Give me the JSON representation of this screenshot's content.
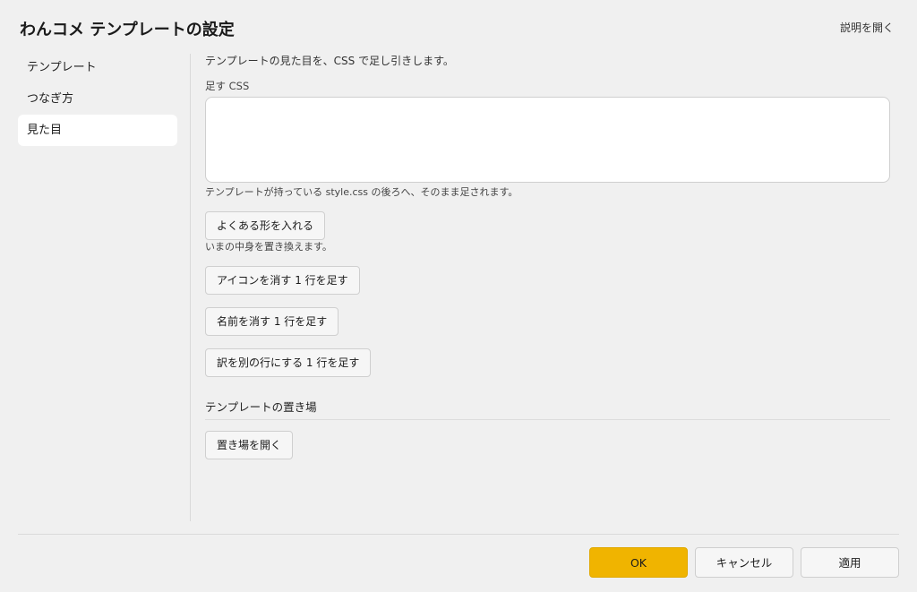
{
  "window": {
    "title": "わんコメ テンプレートの設定",
    "help_link": "説明を開く"
  },
  "sidebar": {
    "items": [
      {
        "label": "テンプレート",
        "active": false
      },
      {
        "label": "つなぎ方",
        "active": false
      },
      {
        "label": "見た目",
        "active": true
      }
    ]
  },
  "main": {
    "intro": "テンプレートの見た目を、CSS で足し引きします。",
    "css_field_label": "足す CSS",
    "css_field_value": "",
    "css_field_note": "テンプレートが持っている style.css の後ろへ、そのまま足されます。",
    "preset_button": "よくある形を入れる",
    "preset_note": "いまの中身を置き換えます。",
    "snippet_buttons": [
      "アイコンを消す 1 行を足す",
      "名前を消す 1 行を足す",
      "訳を別の行にする 1 行を足す"
    ],
    "folder_section_title": "テンプレートの置き場",
    "open_folder_button": "置き場を開く"
  },
  "footer": {
    "ok_label": "OK",
    "cancel_label": "キャンセル",
    "apply_label": "適用"
  },
  "colors": {
    "background": "#f0f0f0",
    "accent": "#f0b400",
    "sidebar_active": "#ffffff"
  }
}
